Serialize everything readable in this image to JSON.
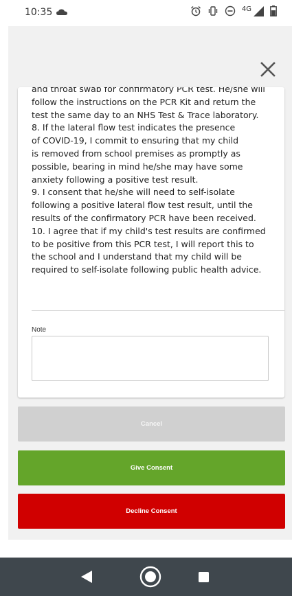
{
  "status_bar": {
    "time": "10:35",
    "network": "4G",
    "icons": [
      "cloud-icon",
      "alarm-icon",
      "vibrate-icon",
      "do-not-disturb-icon",
      "signal-icon",
      "battery-icon"
    ]
  },
  "modal": {
    "close_icon": "close-icon",
    "consent_lines": [
      "and throat swab for confirmatory PCR test. He/she will",
      "follow the instructions on the PCR Kit and return the",
      "test the same day to an NHS Test & Trace laboratory.",
      "8. If the lateral flow test indicates the presence",
      "of COVID-19, I commit to ensuring that my child",
      "is removed from school premises as promptly as",
      "possible, bearing in mind he/she may have some",
      "anxiety following a positive test result.",
      "9. I consent that he/she will need to self-isolate",
      "following a positive lateral flow test result, until the",
      "results of the confirmatory PCR have been received.",
      "10. I agree that if my child's test results are confirmed",
      "to be positive from this PCR test, I will report this to",
      "the school  and I understand that my child will be",
      "required to self-isolate following public health advice."
    ],
    "note_label": "Note",
    "note_value": ""
  },
  "buttons": {
    "cancel": "Cancel",
    "give_consent": "Give Consent",
    "decline_consent": "Decline Consent"
  },
  "colors": {
    "give_consent": "#64a52a",
    "decline_consent": "#d00000",
    "cancel_disabled": "#d0d0d0",
    "nav_bar": "#3f474d"
  },
  "nav_bar": {
    "icons": [
      "back-icon",
      "home-icon",
      "recents-icon"
    ]
  }
}
